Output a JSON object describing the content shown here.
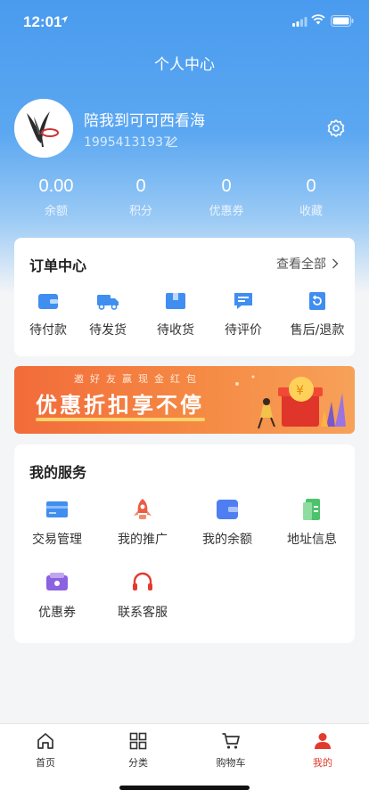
{
  "status_bar": {
    "time": "12:01"
  },
  "page_title": "个人中心",
  "user": {
    "name": "陪我到可可西看海",
    "phone": "19954131937"
  },
  "stats": [
    {
      "value": "0.00",
      "label": "余额"
    },
    {
      "value": "0",
      "label": "积分"
    },
    {
      "value": "0",
      "label": "优惠券"
    },
    {
      "value": "0",
      "label": "收藏"
    }
  ],
  "orders": {
    "title": "订单中心",
    "view_all": "查看全部",
    "items": [
      {
        "label": "待付款",
        "icon": "wallet-icon"
      },
      {
        "label": "待发货",
        "icon": "truck-icon"
      },
      {
        "label": "待收货",
        "icon": "package-icon"
      },
      {
        "label": "待评价",
        "icon": "comment-icon"
      },
      {
        "label": "售后/退款",
        "icon": "refund-icon"
      }
    ]
  },
  "banner": {
    "subtitle": "邀好友赢现金红包",
    "title": "优惠折扣享不停"
  },
  "services": {
    "title": "我的服务",
    "items": [
      {
        "label": "交易管理",
        "icon": "card-icon"
      },
      {
        "label": "我的推广",
        "icon": "rocket-icon"
      },
      {
        "label": "我的余额",
        "icon": "wallet-icon"
      },
      {
        "label": "地址信息",
        "icon": "document-icon"
      },
      {
        "label": "优惠券",
        "icon": "coupon-icon"
      },
      {
        "label": "联系客服",
        "icon": "headset-icon"
      }
    ]
  },
  "tabs": [
    {
      "label": "首页",
      "icon": "home-icon"
    },
    {
      "label": "分类",
      "icon": "grid-icon"
    },
    {
      "label": "购物车",
      "icon": "cart-icon"
    },
    {
      "label": "我的",
      "icon": "user-icon",
      "active": true
    }
  ],
  "colors": {
    "primary": "#4a9bef",
    "accent": "#e23b2e",
    "icon_blue": "#3f8ef0"
  }
}
